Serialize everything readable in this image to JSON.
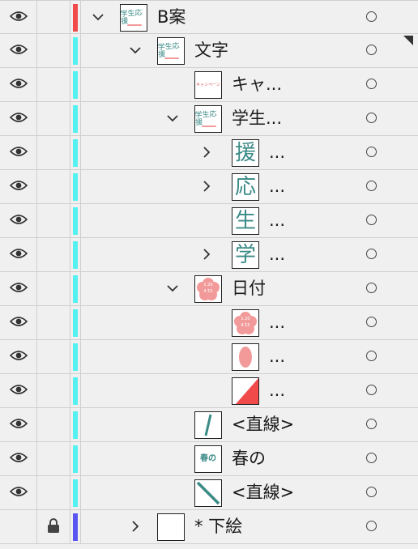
{
  "colors": {
    "panel_bg": "#f0f0f0",
    "layer_red": "#f04a4a",
    "layer_cyan": "#55f0f0",
    "layer_blue": "#5a55f0",
    "accent_pink": "#f29a9a",
    "teal": "#3a8a86"
  },
  "layers": [
    {
      "name": "B案",
      "visible": true,
      "locked": false,
      "color": "red",
      "expanded": true,
      "depth": 0,
      "thumb": "group-art"
    },
    {
      "name": "文字",
      "visible": true,
      "locked": false,
      "color": "cyan",
      "expanded": true,
      "depth": 1,
      "thumb": "group-art"
    },
    {
      "name": "キャ...",
      "visible": true,
      "locked": false,
      "color": "cyan",
      "expanded": null,
      "depth": 2,
      "thumb": "campaign-text"
    },
    {
      "name": "学生...",
      "visible": true,
      "locked": false,
      "color": "cyan",
      "expanded": true,
      "depth": 2,
      "thumb": "group-art"
    },
    {
      "name": "...",
      "visible": true,
      "locked": false,
      "color": "cyan",
      "expanded": false,
      "depth": 3,
      "thumb": "援"
    },
    {
      "name": "...",
      "visible": true,
      "locked": false,
      "color": "cyan",
      "expanded": false,
      "depth": 3,
      "thumb": "応"
    },
    {
      "name": "...",
      "visible": true,
      "locked": false,
      "color": "cyan",
      "expanded": null,
      "depth": 3,
      "thumb": "生"
    },
    {
      "name": "...",
      "visible": true,
      "locked": false,
      "color": "cyan",
      "expanded": false,
      "depth": 3,
      "thumb": "学"
    },
    {
      "name": "日付",
      "visible": true,
      "locked": false,
      "color": "cyan",
      "expanded": true,
      "depth": 2,
      "thumb": "flower"
    },
    {
      "name": "...",
      "visible": true,
      "locked": false,
      "color": "cyan",
      "expanded": null,
      "depth": 3,
      "thumb": "flower"
    },
    {
      "name": "...",
      "visible": true,
      "locked": false,
      "color": "cyan",
      "expanded": null,
      "depth": 3,
      "thumb": "ellipse"
    },
    {
      "name": "...",
      "visible": true,
      "locked": false,
      "color": "cyan",
      "expanded": null,
      "depth": 3,
      "thumb": "triangle"
    },
    {
      "name": "<直線>",
      "visible": true,
      "locked": false,
      "color": "cyan",
      "expanded": null,
      "depth": 2,
      "thumb": "line-steep"
    },
    {
      "name": "春の",
      "visible": true,
      "locked": false,
      "color": "cyan",
      "expanded": null,
      "depth": 2,
      "thumb": "haru"
    },
    {
      "name": "<直線>",
      "visible": true,
      "locked": false,
      "color": "cyan",
      "expanded": null,
      "depth": 2,
      "thumb": "line-diag"
    },
    {
      "name": "* 下絵",
      "visible": false,
      "locked": true,
      "color": "blue",
      "expanded": false,
      "depth": 1,
      "thumb": "blank"
    }
  ],
  "thumb_text": {
    "campaign": "キャンペーン",
    "haru": "春の",
    "group_title": "学生応援",
    "flower": "1.20\n4.15"
  }
}
